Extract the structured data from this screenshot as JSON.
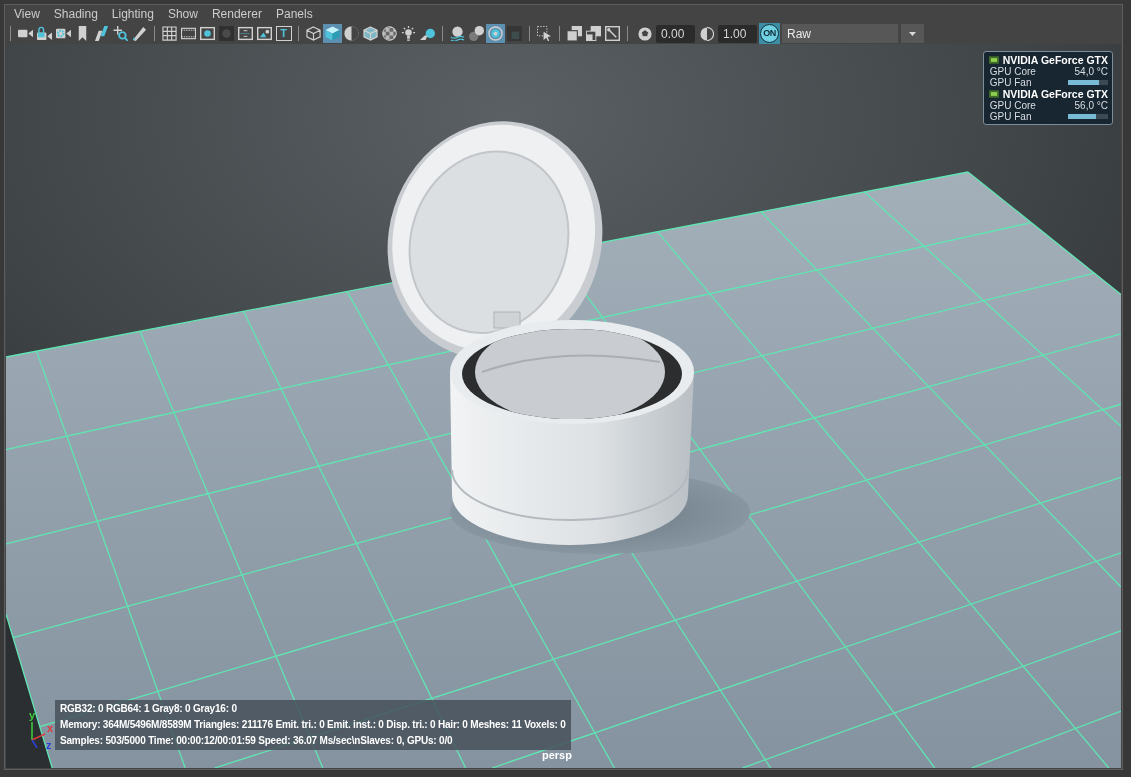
{
  "menu": [
    "View",
    "Shading",
    "Lighting",
    "Show",
    "Renderer",
    "Panels"
  ],
  "toolbar": {
    "groups": [
      {
        "items": [
          {
            "selected": false
          },
          {
            "selected": false
          },
          {
            "selected": false
          },
          {
            "selected": false
          },
          {
            "selected": false
          },
          {
            "selected": false
          },
          {
            "selected": false
          }
        ]
      },
      {
        "items": [
          {
            "selected": false
          },
          {
            "selected": false
          },
          {
            "selected": false
          },
          {
            "selected": false
          },
          {
            "selected": false
          },
          {
            "selected": false
          },
          {
            "selected": false,
            "label": "T"
          }
        ]
      },
      {
        "items": [
          {
            "selected": false
          },
          {
            "selected": true
          },
          {
            "selected": false
          },
          {
            "selected": false
          },
          {
            "selected": false
          },
          {
            "selected": false
          },
          {
            "selected": false
          }
        ]
      },
      {
        "items": [
          {
            "selected": false
          },
          {
            "selected": false
          },
          {
            "selected": true
          },
          {
            "selected": false
          }
        ]
      },
      {
        "items": [
          {
            "selected": false
          }
        ]
      },
      {
        "items": [
          {
            "selected": false
          },
          {
            "selected": false
          },
          {
            "selected": false
          }
        ]
      }
    ],
    "fields": [
      {
        "value": "0.00"
      },
      {
        "value": "1.00"
      }
    ],
    "toggle": {
      "label": "ON",
      "on": true
    },
    "dropdown": {
      "value": "Raw"
    }
  },
  "viewport": {
    "gpu_monitor": [
      {
        "name": "NVIDIA GeForce GTX",
        "core_label": "GPU Core",
        "core_value": "54,0 °C",
        "fan_label": "GPU Fan",
        "level": 0.77
      },
      {
        "name": "NVIDIA GeForce GTX",
        "core_label": "GPU Core",
        "core_value": "56,0 °C",
        "fan_label": "GPU Fan",
        "level": 0.7
      }
    ],
    "stats": [
      "RGB32: 0 RGB64: 1 Gray8: 0 Gray16: 0",
      "Memory: 364M/5496M/8589M Triangles: 211176 Emit. tri.: 0 Emit. inst.: 0 Disp. tri.: 0 Hair: 0 Meshes: 11 Voxels: 0",
      "Samples: 503/5000 Time: 00:00:12/00:01:59 Speed: 36.07 Ms/sec\\nSlaves: 0, GPUs: 0/0"
    ],
    "axes": [
      {
        "label": "y",
        "color": "#3ccf3c"
      },
      {
        "label": "x",
        "color": "#e03a3a"
      },
      {
        "label": "z",
        "color": "#2a40e0"
      }
    ],
    "camera": "persp"
  }
}
